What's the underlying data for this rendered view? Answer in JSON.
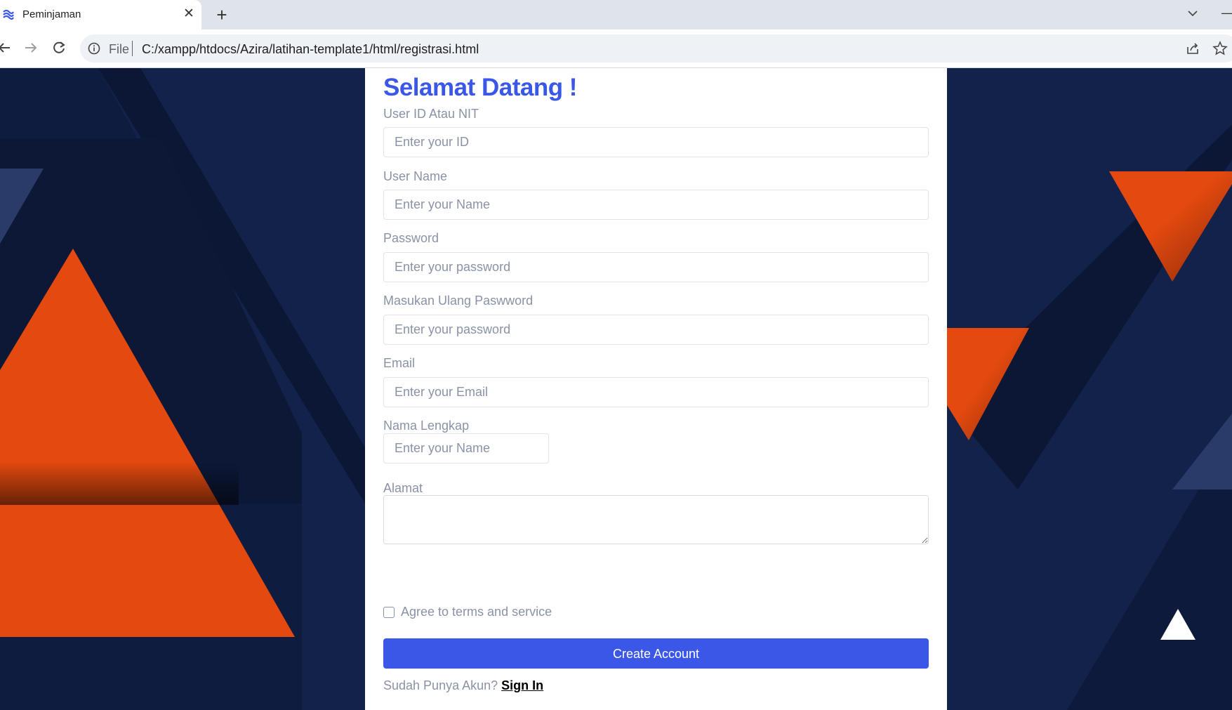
{
  "browser": {
    "tab_title": "Peminjaman",
    "tab_close": "✕",
    "new_tab": "+",
    "scheme": "File",
    "url": "C:/xampp/htdocs/Azira/latihan-template1/html/registrasi.html",
    "icons": [
      "favicon-icon",
      "back-icon",
      "forward-icon",
      "reload-icon",
      "info-icon",
      "share-icon",
      "star-icon",
      "chevron-down-icon"
    ]
  },
  "form": {
    "heading": "Selamat Datang !",
    "fields": [
      {
        "label": "User ID Atau NIT",
        "placeholder": "Enter your ID"
      },
      {
        "label": "User Name",
        "placeholder": "Enter your Name"
      },
      {
        "label": "Password",
        "placeholder": "Enter your password"
      },
      {
        "label": "Masukan Ulang Paswword",
        "placeholder": "Enter your password"
      },
      {
        "label": "Email",
        "placeholder": "Enter your Email"
      },
      {
        "label": "Nama Lengkap",
        "placeholder": "Enter your Name"
      },
      {
        "label": "Alamat",
        "placeholder": ""
      }
    ],
    "terms_label": "Agree to terms and service",
    "submit_label": "Create Account",
    "signin_prompt": "Sudah Punya Akun?",
    "signin_link": "Sign In"
  },
  "colors": {
    "primary": "#3a57e8",
    "background_navy": "#13224a",
    "accent_orange": "#e44a0f",
    "label_gray": "#8a92a6"
  }
}
